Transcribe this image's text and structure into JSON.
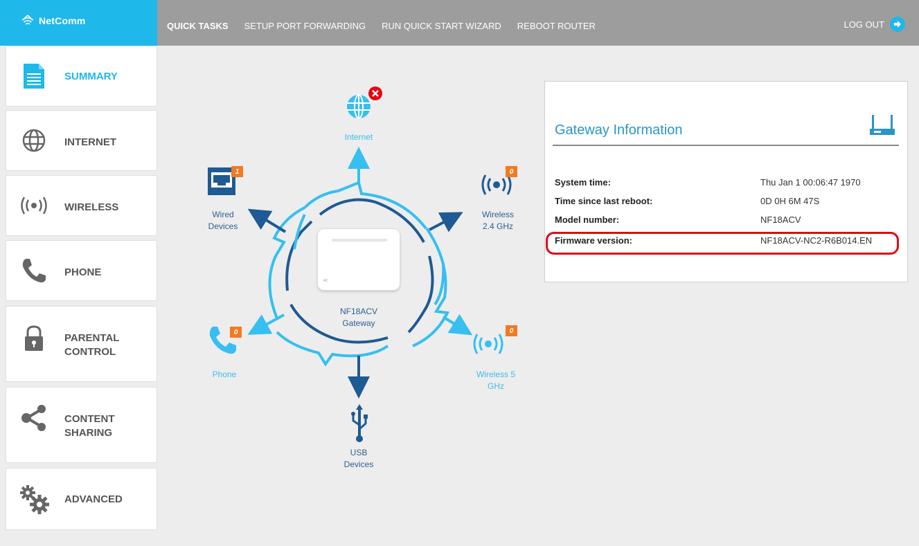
{
  "brand": {
    "name": "NetComm"
  },
  "topnav": {
    "quick_tasks": "QUICK TASKS",
    "port_forwarding": "SETUP PORT FORWARDING",
    "quick_start": "RUN QUICK START WIZARD",
    "reboot": "REBOOT ROUTER",
    "logout": "LOG OUT"
  },
  "sidebar": {
    "items": [
      {
        "label": "SUMMARY",
        "icon": "document-icon",
        "active": true
      },
      {
        "label": "INTERNET",
        "icon": "globe-icon"
      },
      {
        "label": "WIRELESS",
        "icon": "wireless-icon"
      },
      {
        "label": "PHONE",
        "icon": "phone-icon"
      },
      {
        "label": "PARENTAL",
        "label2": "CONTROL",
        "icon": "lock-icon"
      },
      {
        "label": "CONTENT",
        "label2": "SHARING",
        "icon": "share-icon"
      },
      {
        "label": "ADVANCED",
        "icon": "gears-icon"
      }
    ]
  },
  "diagram": {
    "internet": "Internet",
    "wired_1": "Wired",
    "wired_2": "Devices",
    "wired_badge": "1",
    "wifi24_1": "Wireless",
    "wifi24_2": "2.4 GHz",
    "wifi24_badge": "0",
    "gateway_1": "NF18ACV",
    "gateway_2": "Gateway",
    "phone": "Phone",
    "phone_badge": "0",
    "wifi5_1": "Wireless 5",
    "wifi5_2": "GHz",
    "wifi5_badge": "0",
    "usb_1": "USB",
    "usb_2": "Devices"
  },
  "gateway_info": {
    "title": "Gateway Information",
    "rows": [
      {
        "key": "System time:",
        "value": "Thu Jan 1 00:06:47 1970"
      },
      {
        "key": "Time since last reboot:",
        "value": "0D 0H 6M 47S"
      },
      {
        "key": "Model number:",
        "value": "NF18ACV"
      },
      {
        "key": "Firmware version:",
        "value": "NF18ACV-NC2-R6B014.EN"
      }
    ]
  },
  "colors": {
    "accent": "#1fb8ea",
    "topbar": "#9d9d9d",
    "dark_blue": "#1e5a93",
    "badge": "#f47920",
    "highlight": "#e30613"
  }
}
